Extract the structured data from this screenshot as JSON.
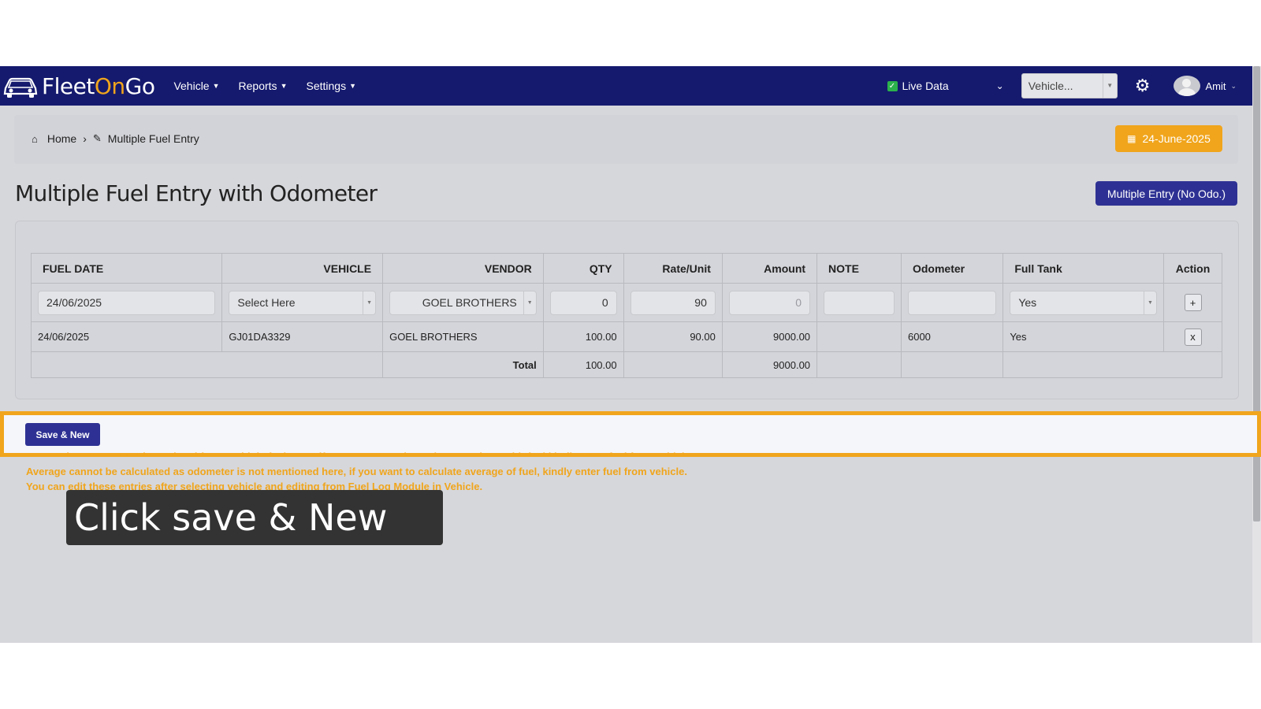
{
  "brand": {
    "part1": "Fleet",
    "part2": "On",
    "part3": "Go"
  },
  "nav": {
    "items": [
      {
        "label": "Vehicle"
      },
      {
        "label": "Reports"
      },
      {
        "label": "Settings"
      }
    ],
    "live_data_label": "Live Data",
    "vehicle_select_placeholder": "Vehicle...",
    "user_name": "Amit"
  },
  "breadcrumb": {
    "home": "Home",
    "current": "Multiple Fuel Entry"
  },
  "date_button": "24-June-2025",
  "page": {
    "title": "Multiple Fuel Entry with Odometer",
    "multi_entry_button": "Multiple Entry (No Odo.)"
  },
  "table": {
    "headers": [
      "FUEL DATE",
      "VEHICLE",
      "VENDOR",
      "QTY",
      "Rate/Unit",
      "Amount",
      "NOTE",
      "Odometer",
      "Full Tank",
      "Action"
    ],
    "input_row": {
      "fuel_date": "24/06/2025",
      "vehicle_placeholder": "Select Here",
      "vendor": "GOEL BROTHERS",
      "qty": "0",
      "rate": "90",
      "amount": "0",
      "note": "",
      "odometer": "",
      "full_tank": "Yes",
      "action": "+"
    },
    "rows": [
      {
        "fuel_date": "24/06/2025",
        "vehicle": "GJ01DA3329",
        "vendor": "GOEL BROTHERS",
        "qty": "100.00",
        "rate": "90.00",
        "amount": "9000.00",
        "note": "",
        "odometer": "6000",
        "full_tank": "Yes",
        "action": "x"
      }
    ],
    "total": {
      "label": "Total",
      "qty": "100.00",
      "amount": "9000.00"
    }
  },
  "save_button": "Save & New",
  "notes": [
    "Note: Odometer cannot be updated from multiple fuel entry, if you want to update odometer along with fuel kindly enter fuel from vehicle.",
    "Average cannot be calculated as odometer is not mentioned here, if you want to calculate average of fuel, kindly enter fuel from vehicle.",
    "You can edit these entries after selecting vehicle and editing from Fuel Log Module in Vehicle."
  ],
  "tooltip": "Click save & New",
  "colors": {
    "navbar": "#151a6e",
    "accent": "#f0a51c",
    "primary_button": "#2e3193",
    "background": "#d6d7db"
  },
  "icons": [
    "car-logo-icon",
    "check-icon",
    "chevron-down-icon",
    "gear-icon",
    "avatar-icon",
    "home-icon",
    "edit-icon",
    "calendar-icon"
  ]
}
